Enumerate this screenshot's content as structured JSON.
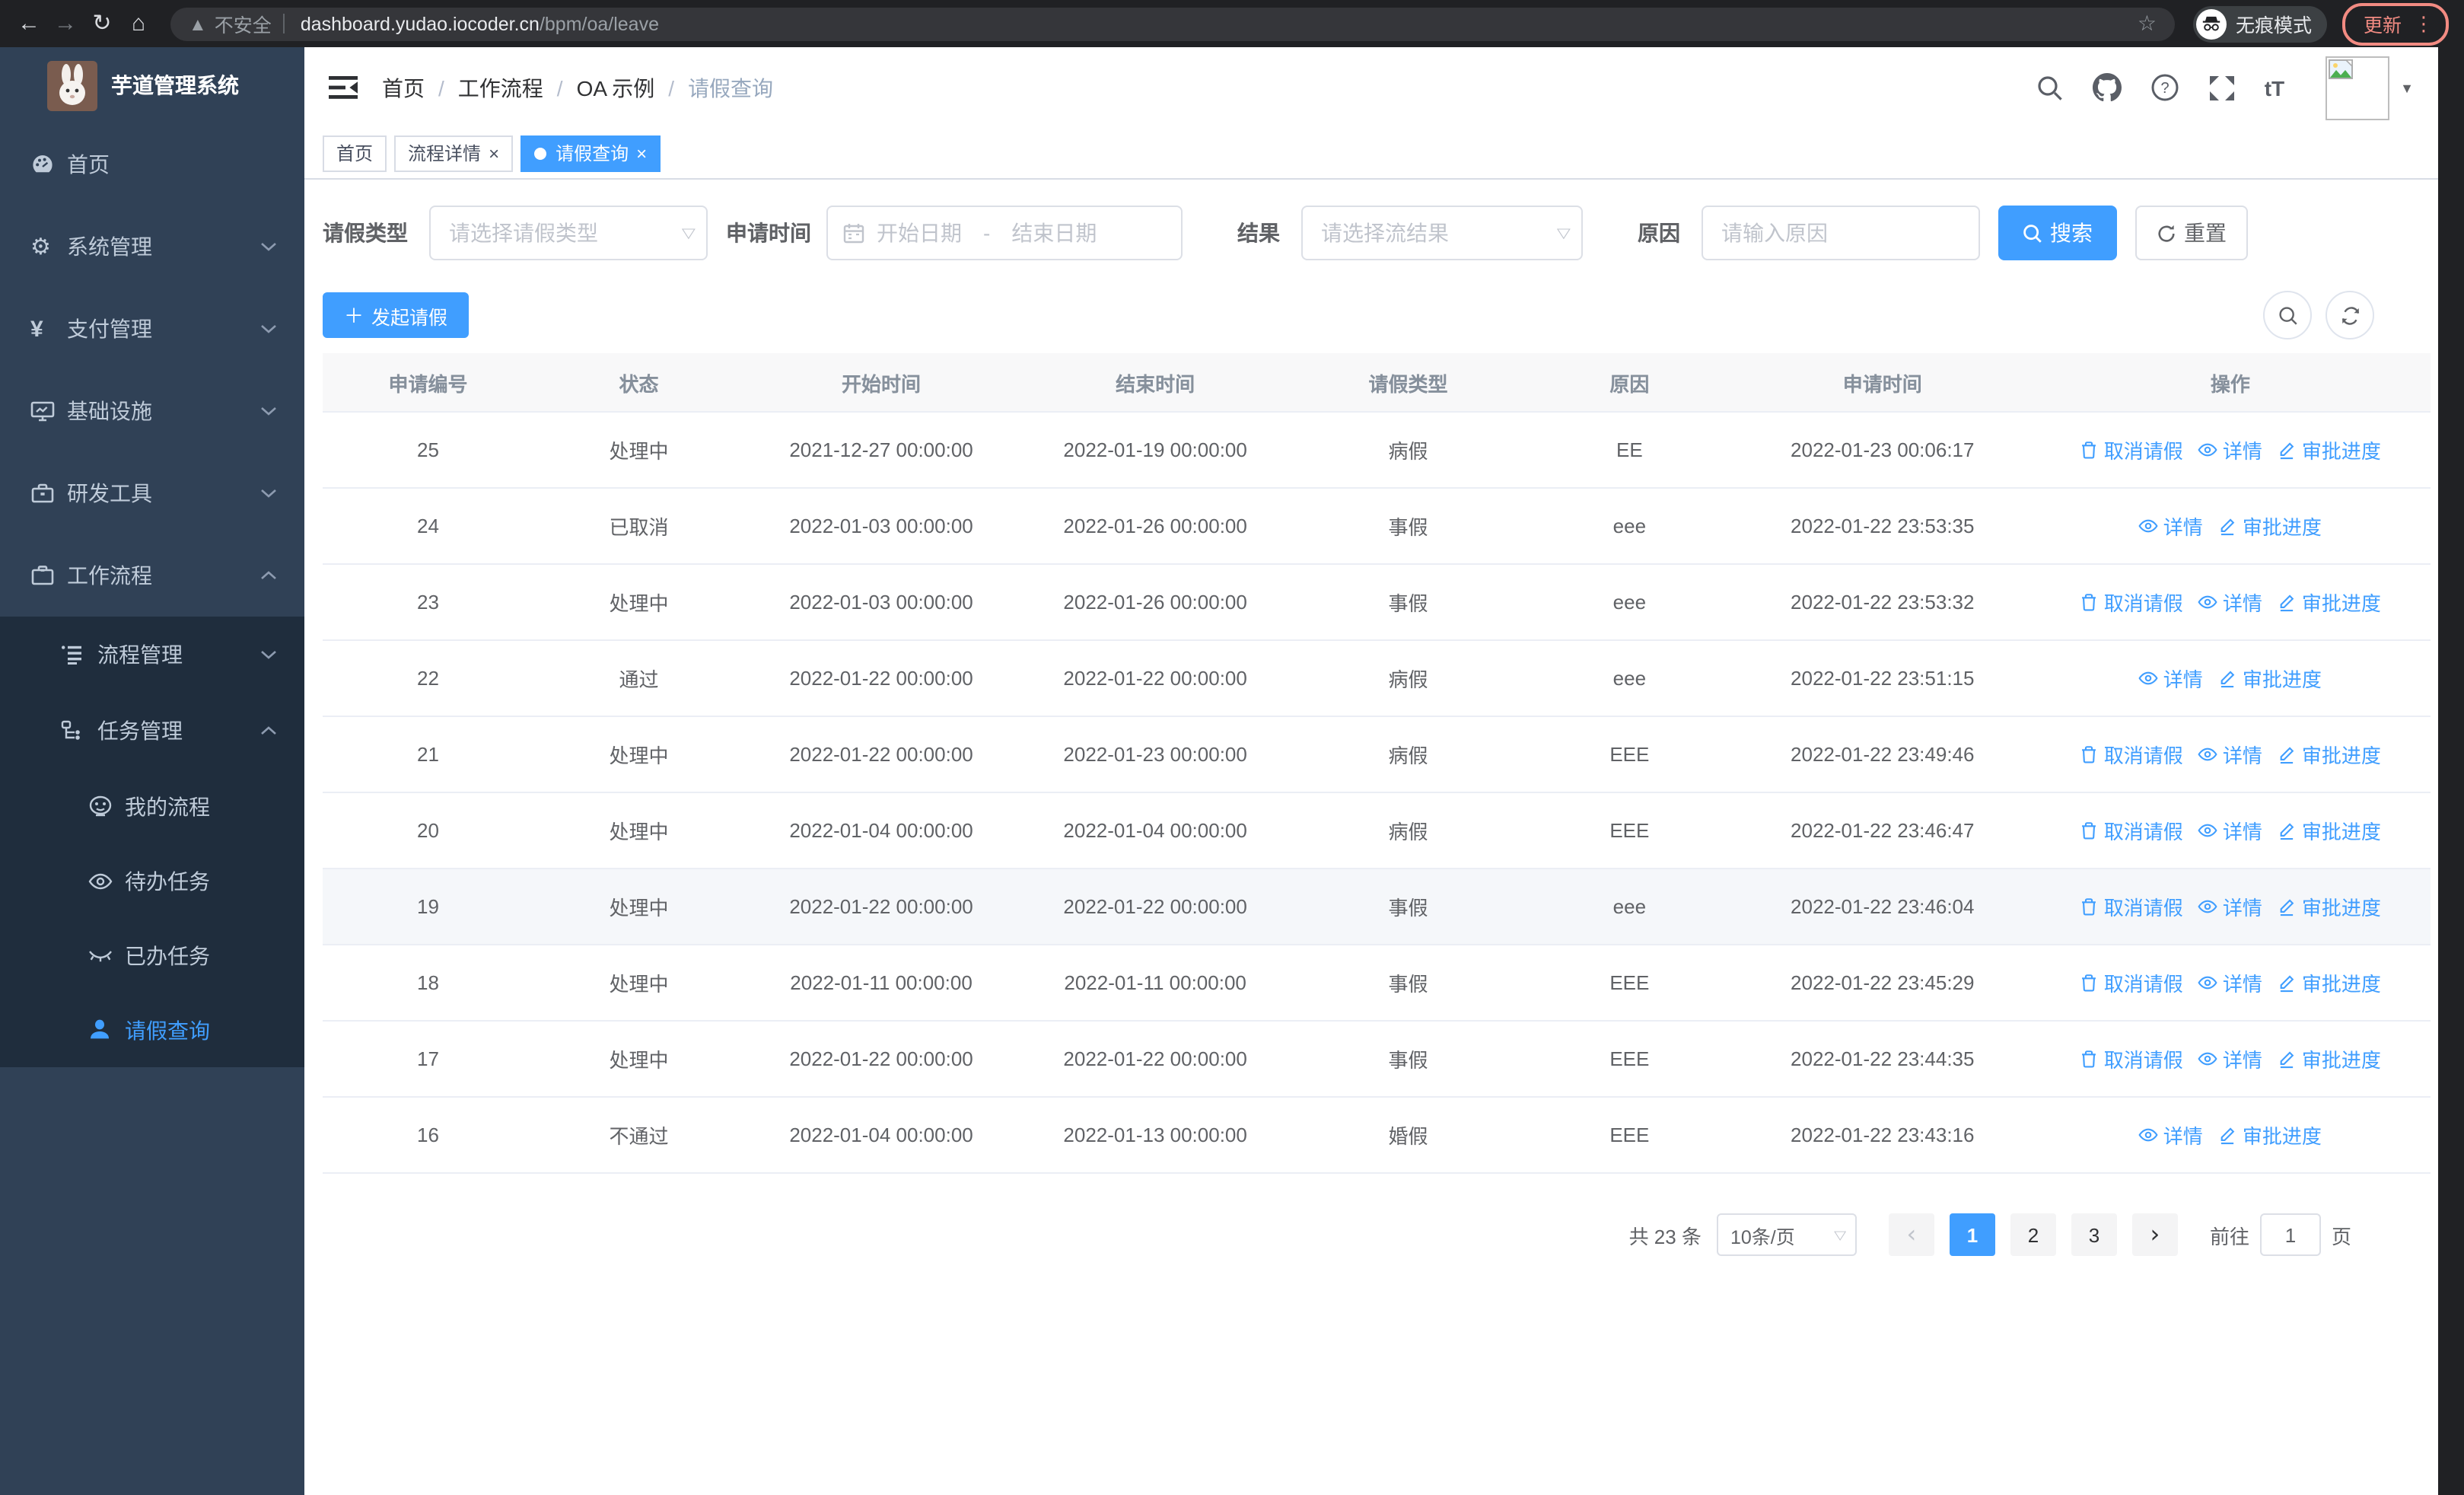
{
  "browser": {
    "security_label": "不安全",
    "url_domain": "dashboard.yudao.iocoder.cn",
    "url_path": "/bpm/oa/leave",
    "incognito_label": "无痕模式",
    "update_label": "更新"
  },
  "sidebar": {
    "title": "芋道管理系统",
    "menu": [
      {
        "label": "首页"
      },
      {
        "label": "系统管理"
      },
      {
        "label": "支付管理"
      },
      {
        "label": "基础设施"
      },
      {
        "label": "研发工具"
      },
      {
        "label": "工作流程"
      },
      {
        "label": "流程管理"
      },
      {
        "label": "任务管理"
      },
      {
        "label": "我的流程"
      },
      {
        "label": "待办任务"
      },
      {
        "label": "已办任务"
      },
      {
        "label": "请假查询"
      }
    ]
  },
  "breadcrumb": {
    "separator": "/",
    "items": [
      "首页",
      "工作流程",
      "OA 示例",
      "请假查询"
    ]
  },
  "tags": {
    "items": [
      {
        "label": "首页"
      },
      {
        "label": "流程详情"
      },
      {
        "label": "请假查询"
      }
    ]
  },
  "filters": {
    "leave_type_label": "请假类型",
    "leave_type_placeholder": "请选择请假类型",
    "apply_time_label": "申请时间",
    "start_placeholder": "开始日期",
    "range_separator": "-",
    "end_placeholder": "结束日期",
    "result_label": "结果",
    "result_placeholder": "请选择流结果",
    "reason_label": "原因",
    "reason_placeholder": "请输入原因",
    "search_label": "搜索",
    "reset_label": "重置"
  },
  "toolbar": {
    "create_label": "发起请假"
  },
  "table": {
    "headers": [
      "申请编号",
      "状态",
      "开始时间",
      "结束时间",
      "请假类型",
      "原因",
      "申请时间",
      "操作"
    ],
    "action_labels": {
      "cancel": "取消请假",
      "detail": "详情",
      "progress": "审批进度"
    },
    "rows": [
      {
        "id": "25",
        "status": "处理中",
        "start_time": "2021-12-27 00:00:00",
        "end_time": "2022-01-19 00:00:00",
        "leave_type": "病假",
        "reason": "EE",
        "apply_time": "2022-01-23 00:06:17",
        "can_cancel": true,
        "highlighted": false
      },
      {
        "id": "24",
        "status": "已取消",
        "start_time": "2022-01-03 00:00:00",
        "end_time": "2022-01-26 00:00:00",
        "leave_type": "事假",
        "reason": "eee",
        "apply_time": "2022-01-22 23:53:35",
        "can_cancel": false,
        "highlighted": false
      },
      {
        "id": "23",
        "status": "处理中",
        "start_time": "2022-01-03 00:00:00",
        "end_time": "2022-01-26 00:00:00",
        "leave_type": "事假",
        "reason": "eee",
        "apply_time": "2022-01-22 23:53:32",
        "can_cancel": true,
        "highlighted": false
      },
      {
        "id": "22",
        "status": "通过",
        "start_time": "2022-01-22 00:00:00",
        "end_time": "2022-01-22 00:00:00",
        "leave_type": "病假",
        "reason": "eee",
        "apply_time": "2022-01-22 23:51:15",
        "can_cancel": false,
        "highlighted": false
      },
      {
        "id": "21",
        "status": "处理中",
        "start_time": "2022-01-22 00:00:00",
        "end_time": "2022-01-23 00:00:00",
        "leave_type": "病假",
        "reason": "EEE",
        "apply_time": "2022-01-22 23:49:46",
        "can_cancel": true,
        "highlighted": false
      },
      {
        "id": "20",
        "status": "处理中",
        "start_time": "2022-01-04 00:00:00",
        "end_time": "2022-01-04 00:00:00",
        "leave_type": "病假",
        "reason": "EEE",
        "apply_time": "2022-01-22 23:46:47",
        "can_cancel": true,
        "highlighted": false
      },
      {
        "id": "19",
        "status": "处理中",
        "start_time": "2022-01-22 00:00:00",
        "end_time": "2022-01-22 00:00:00",
        "leave_type": "事假",
        "reason": "eee",
        "apply_time": "2022-01-22 23:46:04",
        "can_cancel": true,
        "highlighted": true
      },
      {
        "id": "18",
        "status": "处理中",
        "start_time": "2022-01-11 00:00:00",
        "end_time": "2022-01-11 00:00:00",
        "leave_type": "事假",
        "reason": "EEE",
        "apply_time": "2022-01-22 23:45:29",
        "can_cancel": true,
        "highlighted": false
      },
      {
        "id": "17",
        "status": "处理中",
        "start_time": "2022-01-22 00:00:00",
        "end_time": "2022-01-22 00:00:00",
        "leave_type": "事假",
        "reason": "EEE",
        "apply_time": "2022-01-22 23:44:35",
        "can_cancel": true,
        "highlighted": false
      },
      {
        "id": "16",
        "status": "不通过",
        "start_time": "2022-01-04 00:00:00",
        "end_time": "2022-01-13 00:00:00",
        "leave_type": "婚假",
        "reason": "EEE",
        "apply_time": "2022-01-22 23:43:16",
        "can_cancel": false,
        "highlighted": false
      }
    ]
  },
  "pagination": {
    "total": "共 23 条",
    "page_size": "10条/页",
    "pages": [
      "1",
      "2",
      "3"
    ],
    "active_page": "1",
    "goto_label": "前往",
    "goto_value": "1",
    "unit_label": "页"
  },
  "colors": {
    "accent": "#409eff",
    "sidebar_bg": "#304156",
    "submenu_bg": "#1f2d3d",
    "chrome_bg": "#202124",
    "update_accent": "#f28b82"
  }
}
